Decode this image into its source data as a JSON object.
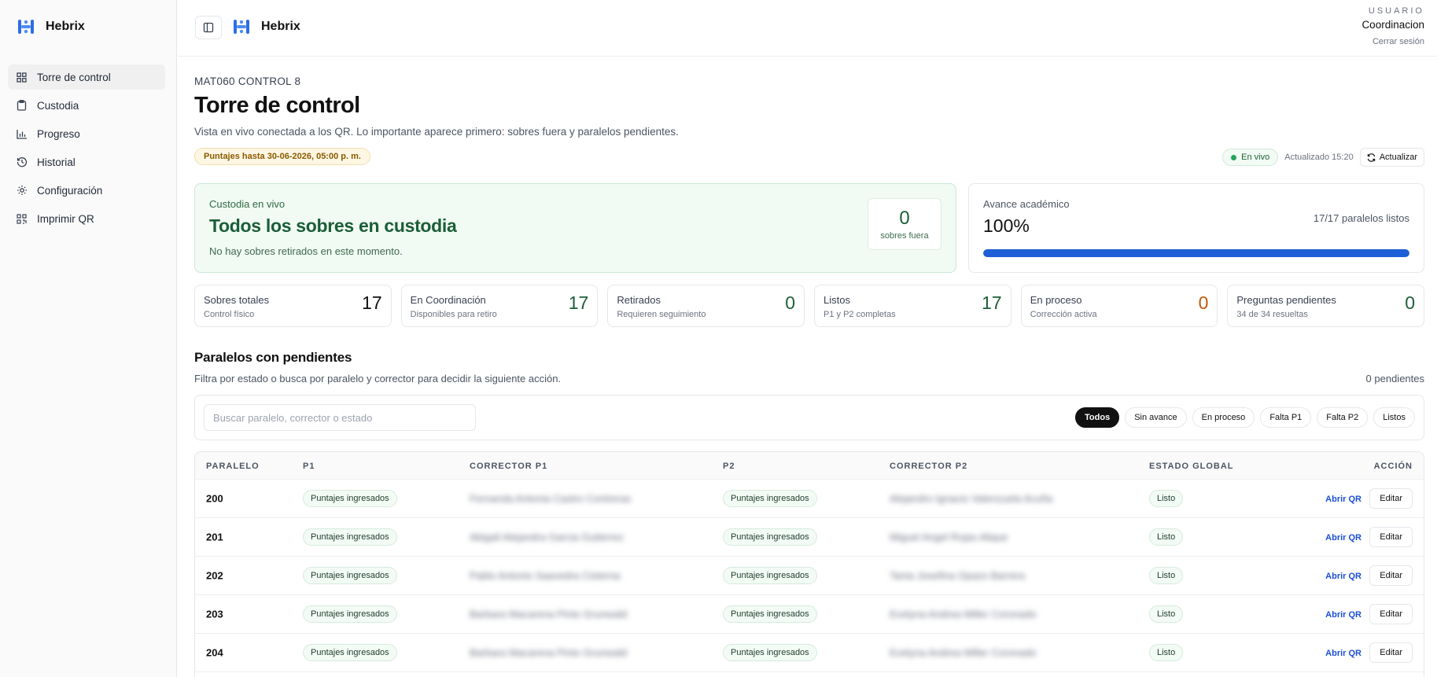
{
  "app": {
    "name": "Hebrix"
  },
  "sidebar": {
    "items": [
      {
        "label": "Torre de control",
        "icon": "grid-icon"
      },
      {
        "label": "Custodia",
        "icon": "clipboard-icon"
      },
      {
        "label": "Progreso",
        "icon": "bar-chart-icon"
      },
      {
        "label": "Historial",
        "icon": "history-icon"
      },
      {
        "label": "Configuración",
        "icon": "gear-icon"
      },
      {
        "label": "Imprimir QR",
        "icon": "qr-icon"
      }
    ]
  },
  "user": {
    "label": "USUARIO",
    "name": "Coordinacion",
    "logout": "Cerrar sesión"
  },
  "page": {
    "eyebrow": "MAT060 CONTROL 8",
    "title": "Torre de control",
    "description": "Vista en vivo conectada a los QR. Lo importante aparece primero: sobres fuera y paralelos pendientes.",
    "deadline": "Puntajes hasta 30-06-2026, 05:00 p. m.",
    "live": "En vivo",
    "updated": "Actualizado 15:20",
    "refresh": "Actualizar"
  },
  "custody": {
    "subtitle": "Custodia en vivo",
    "title": "Todos los sobres en custodia",
    "description": "No hay sobres retirados en este momento.",
    "out_value": "0",
    "out_label": "sobres fuera"
  },
  "progress": {
    "subtitle": "Avance académico",
    "value": "100%",
    "fraction": 1.0,
    "right_label": "17/17 paralelos listos"
  },
  "stats": [
    {
      "label": "Sobres totales",
      "sub": "Control físico",
      "value": "17",
      "color": "#111111"
    },
    {
      "label": "En Coordinación",
      "sub": "Disponibles para retiro",
      "value": "17",
      "color": "#1b5e36"
    },
    {
      "label": "Retirados",
      "sub": "Requieren seguimiento",
      "value": "0",
      "color": "#1b5e36"
    },
    {
      "label": "Listos",
      "sub": "P1 y P2 completas",
      "value": "17",
      "color": "#1b5e36"
    },
    {
      "label": "En proceso",
      "sub": "Corrección activa",
      "value": "0",
      "color": "#c2570c"
    },
    {
      "label": "Preguntas pendientes",
      "sub": "34 de 34 resueltas",
      "value": "0",
      "color": "#1b5e36"
    }
  ],
  "section": {
    "title": "Paralelos con pendientes",
    "description": "Filtra por estado o busca por paralelo y corrector para decidir la siguiente acción.",
    "count": "0 pendientes"
  },
  "search": {
    "placeholder": "Buscar paralelo, corrector o estado"
  },
  "filters": [
    "Todos",
    "Sin avance",
    "En proceso",
    "Falta P1",
    "Falta P2",
    "Listos"
  ],
  "table": {
    "headers": [
      "PARALELO",
      "P1",
      "CORRECTOR P1",
      "P2",
      "CORRECTOR P2",
      "ESTADO GLOBAL",
      "ACCIÓN"
    ],
    "rows": [
      {
        "paralelo": "200",
        "p1": "Puntajes ingresados",
        "corrector_p1": "Fernanda Antonia Castro Contreras",
        "p2": "Puntajes ingresados",
        "corrector_p2": "Alejandro Ignacio Valenzuela Acuña",
        "estado": "Listo"
      },
      {
        "paralelo": "201",
        "p1": "Puntajes ingresados",
        "corrector_p1": "Abigail Alejandra Garcia Gutierrez",
        "p2": "Puntajes ingresados",
        "corrector_p2": "Miguel Angel Rojas Alique",
        "estado": "Listo"
      },
      {
        "paralelo": "202",
        "p1": "Puntajes ingresados",
        "corrector_p1": "Pablo Antonio Saavedra Cisterna",
        "p2": "Puntajes ingresados",
        "corrector_p2": "Tania Josefina Opazo Barrera",
        "estado": "Listo"
      },
      {
        "paralelo": "203",
        "p1": "Puntajes ingresados",
        "corrector_p1": "Barbara Macarena Pinto Grunwald",
        "p2": "Puntajes ingresados",
        "corrector_p2": "Evelyna Andrea Miller Coronado",
        "estado": "Listo"
      },
      {
        "paralelo": "204",
        "p1": "Puntajes ingresados",
        "corrector_p1": "Barbara Macarena Pinto Grunwald",
        "p2": "Puntajes ingresados",
        "corrector_p2": "Evelyna Andrea Miller Coronado",
        "estado": "Listo"
      }
    ],
    "action_qr": "Abrir QR",
    "action_edit": "Editar"
  }
}
